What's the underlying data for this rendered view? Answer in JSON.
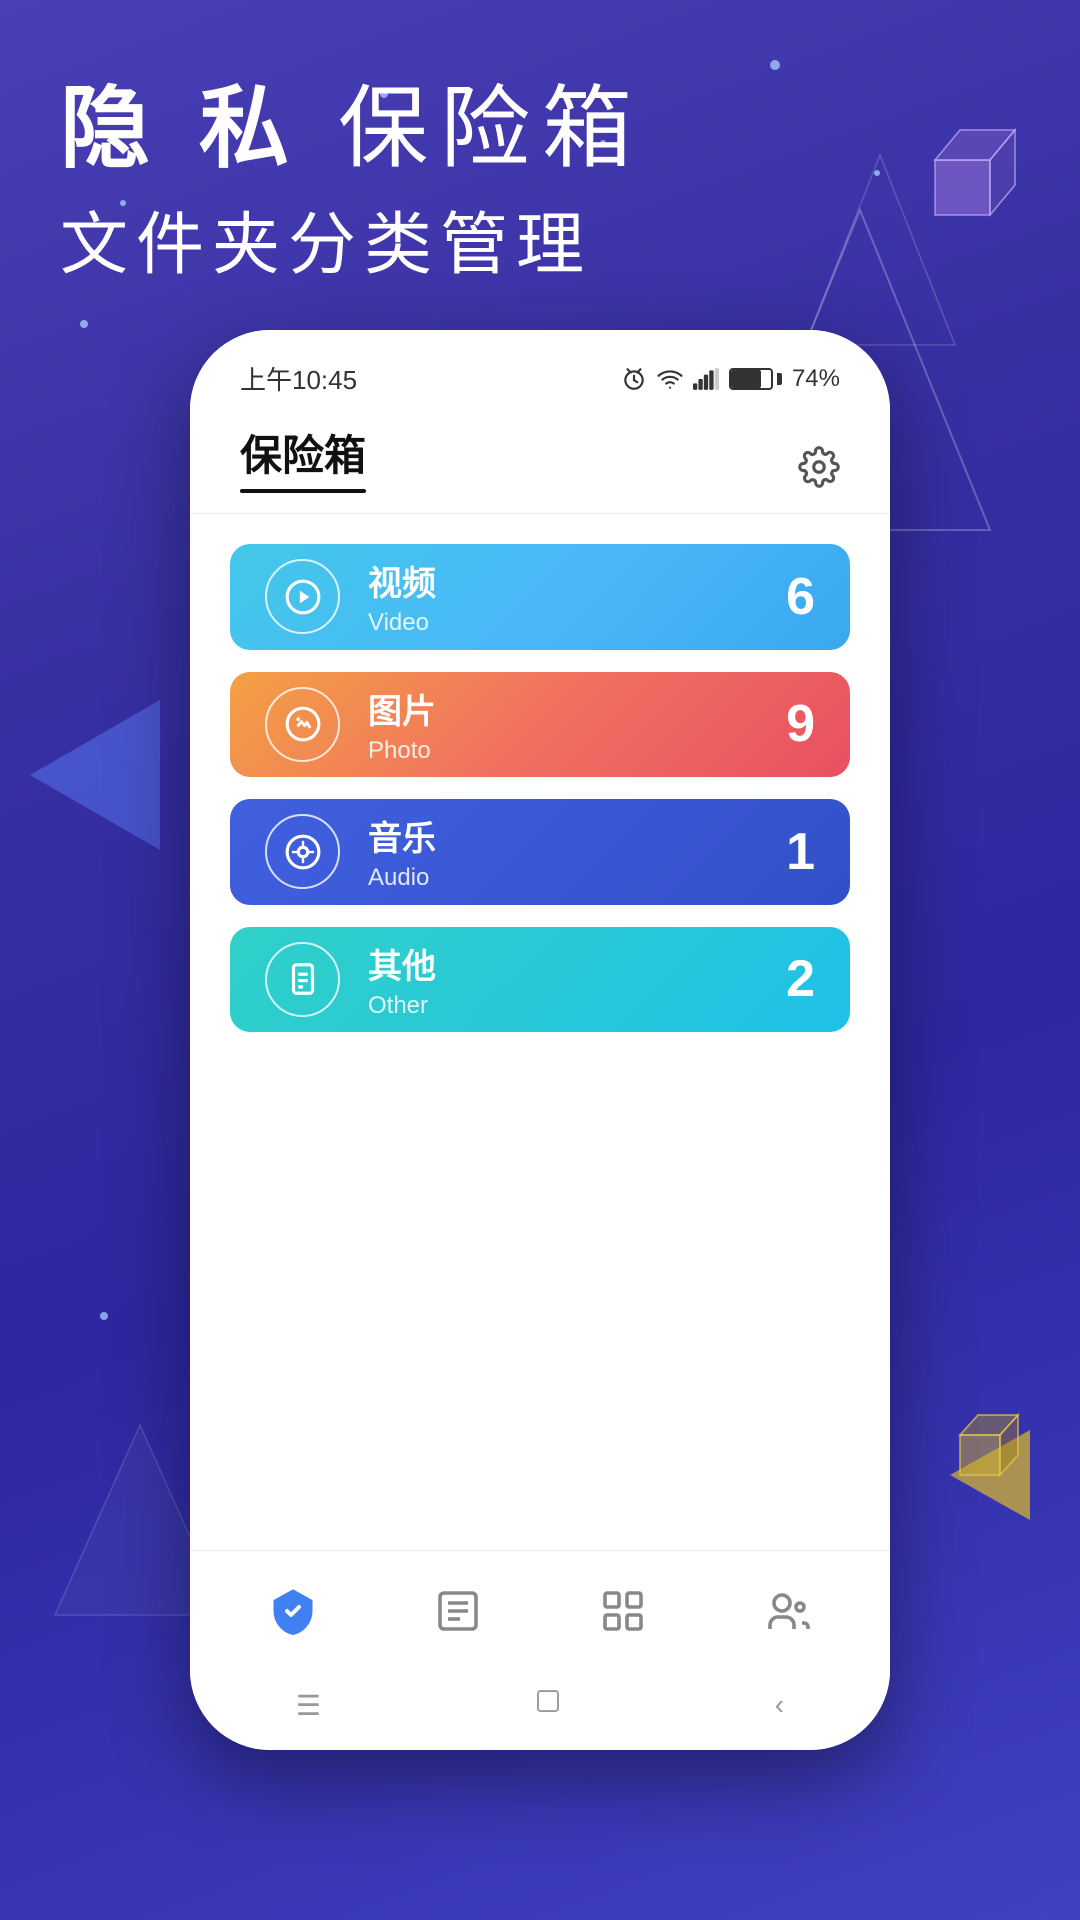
{
  "page": {
    "bg_gradient_start": "#4a3fb5",
    "bg_gradient_end": "#3730a3"
  },
  "header": {
    "line1_part1": "隐 私",
    "line1_part2": "保险箱",
    "line2": "文件夹分类管理"
  },
  "status_bar": {
    "time": "上午10:45",
    "battery_percent": "74%"
  },
  "app": {
    "title": "保险箱",
    "settings_label": "settings"
  },
  "categories": [
    {
      "id": "video",
      "name_zh": "视频",
      "name_en": "Video",
      "count": "6",
      "gradient": "video"
    },
    {
      "id": "photo",
      "name_zh": "图片",
      "name_en": "Photo",
      "count": "9",
      "gradient": "photo"
    },
    {
      "id": "audio",
      "name_zh": "音乐",
      "name_en": "Audio",
      "count": "1",
      "gradient": "audio"
    },
    {
      "id": "other",
      "name_zh": "其他",
      "name_en": "Other",
      "count": "2",
      "gradient": "other"
    }
  ],
  "bottom_nav": [
    {
      "id": "safe",
      "label": "safe",
      "active": true
    },
    {
      "id": "files",
      "label": "files",
      "active": false
    },
    {
      "id": "apps",
      "label": "apps",
      "active": false
    },
    {
      "id": "profile",
      "label": "profile",
      "active": false
    }
  ]
}
